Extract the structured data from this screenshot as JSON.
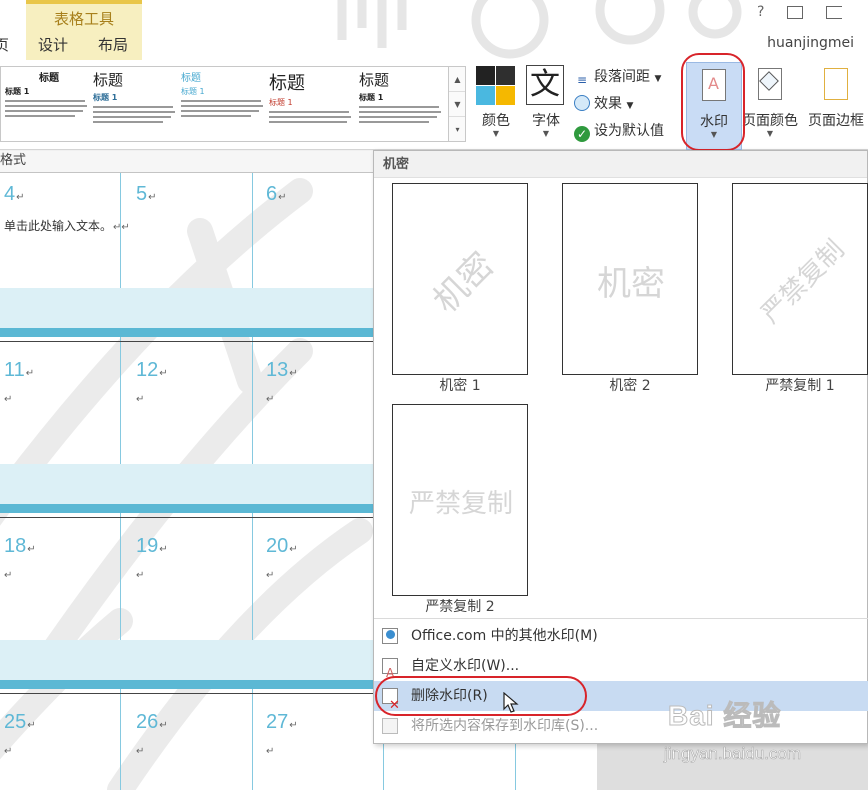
{
  "ribbon_tabs": {
    "partial_tab": "页",
    "context_group_title": "表格工具",
    "design": "设计",
    "layout": "布局"
  },
  "window": {
    "help": "?",
    "user_name": "huanjingmei"
  },
  "style_gallery": {
    "items": [
      {
        "title": "标题",
        "subtitle": "标题 1"
      },
      {
        "title": "标题",
        "subtitle": "标题 1"
      },
      {
        "title": "标题",
        "subtitle": "标题 1"
      },
      {
        "title": "标题",
        "subtitle": "标题 1"
      },
      {
        "title": "标题",
        "subtitle": "标题 1"
      }
    ]
  },
  "design_commands": {
    "colors": "颜色",
    "fonts": "字体",
    "fonts_glyph": "文",
    "paragraph_spacing": "段落间距",
    "effects": "效果",
    "set_as_default": "设为默认值",
    "watermark": "水印",
    "page_color": "页面颜色",
    "page_borders": "页面边框"
  },
  "document": {
    "heading_fragment": "格式",
    "placeholder_text": "单击此处输入文本。",
    "rows": [
      {
        "days": [
          "4",
          "5",
          "6"
        ]
      },
      {
        "days": [
          "11",
          "12",
          "13"
        ]
      },
      {
        "days": [
          "18",
          "19",
          "20"
        ]
      },
      {
        "days": [
          "25",
          "26",
          "27"
        ]
      }
    ]
  },
  "watermark_menu": {
    "category": "机密",
    "thumbnails": [
      {
        "caption": "机密 1",
        "text": "机密"
      },
      {
        "caption": "机密 2",
        "text": "机密"
      },
      {
        "caption": "严禁复制 1",
        "text": "严禁复制"
      },
      {
        "caption": "严禁复制 2",
        "text": "严禁复制"
      }
    ],
    "items": {
      "office_more": "Office.com 中的其他水印(M)",
      "custom": "自定义水印(W)...",
      "remove": "删除水印(R)",
      "save_selection": "将所选内容保存到水印库(S)..."
    }
  },
  "overlay": {
    "brand_logo": "Bai 经验",
    "brand_url": "jingyan.baidu.com"
  },
  "colors": {
    "accent_blue": "#5fb8d6",
    "highlight": "#c9dcf5",
    "annotation_red": "#d8242a",
    "context_tab": "#f7efc0"
  }
}
